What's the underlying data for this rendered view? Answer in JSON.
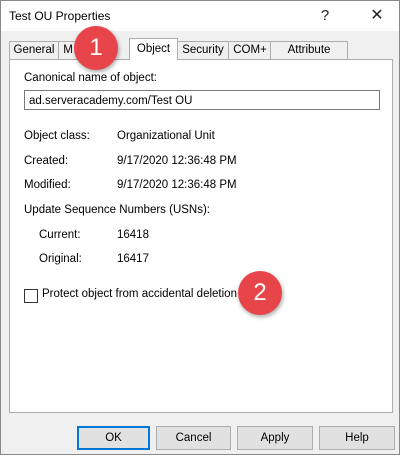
{
  "window": {
    "title": "Test OU Properties",
    "help_glyph": "?",
    "close_glyph": "✕"
  },
  "tabs": [
    {
      "label": "General"
    },
    {
      "label": "M"
    },
    {
      "label": "Object"
    },
    {
      "label": "Security"
    },
    {
      "label": "COM+"
    },
    {
      "label": "Attribute Editor"
    }
  ],
  "object": {
    "canonical_label": "Canonical name of object:",
    "canonical_value": "ad.serveracademy.com/Test OU",
    "class_label": "Object class:",
    "class_value": "Organizational Unit",
    "created_label": "Created:",
    "created_value": "9/17/2020 12:36:48 PM",
    "modified_label": "Modified:",
    "modified_value": "9/17/2020 12:36:48 PM",
    "usn_label": "Update Sequence Numbers (USNs):",
    "current_label": "Current:",
    "current_value": "16418",
    "original_label": "Original:",
    "original_value": "16417",
    "protect_label": "Protect object from accidental deletion",
    "protect_checked": false
  },
  "badges": {
    "one": "1",
    "two": "2",
    "color": "#e8454a"
  },
  "buttons": {
    "ok": "OK",
    "cancel": "Cancel",
    "apply": "Apply",
    "help": "Help"
  }
}
